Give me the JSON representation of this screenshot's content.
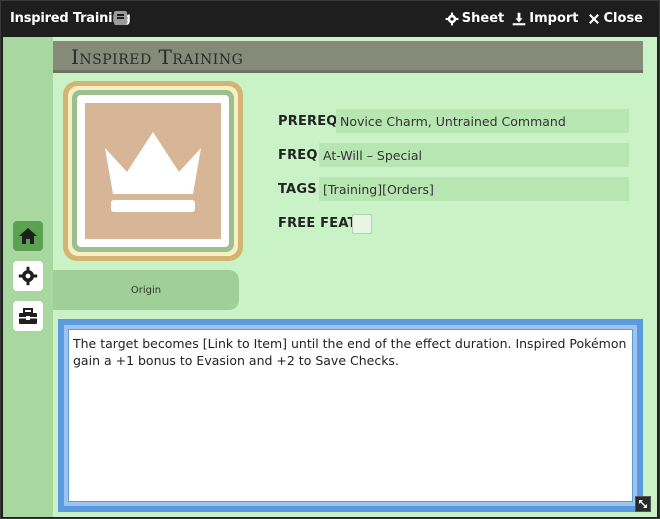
{
  "window": {
    "title": "Inspired Training",
    "actions": {
      "sheet": "Sheet",
      "import": "Import",
      "close": "Close"
    }
  },
  "sidebar": {
    "items": [
      "home-icon",
      "gear-icon",
      "toolbox-icon"
    ]
  },
  "header": {
    "title": "Inspired Training"
  },
  "portrait": {
    "icon": "crown-icon"
  },
  "origin": {
    "label": "Origin"
  },
  "fields": {
    "prereq": {
      "label": "PREREQ",
      "value": "Novice Charm, Untrained Command"
    },
    "freq": {
      "label": "FREQ",
      "value": "At-Will – Special"
    },
    "tags": {
      "label": "TAGS",
      "value": "[Training][Orders]"
    },
    "free_feat": {
      "label": "FREE FEAT",
      "checked": false
    }
  },
  "description": {
    "text": "The target becomes [Link to Item] until the end of the effect duration. Inspired Pokémon gain a +1 bonus to Evasion and +2 to Save Checks."
  },
  "colors": {
    "accent": "#5aa24f",
    "background": "#c9f2c6",
    "description_border": "#5c9ae0"
  }
}
